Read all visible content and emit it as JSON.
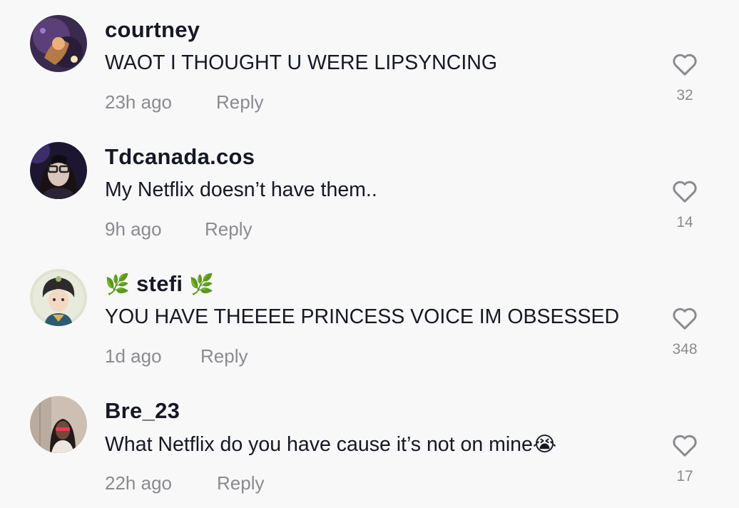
{
  "reply_label": "Reply",
  "comments": [
    {
      "username": "courtney",
      "text": "WAOT I THOUGHT U WERE LIPSYNCING",
      "time": "23h ago",
      "likes": "32"
    },
    {
      "username": "Tdcanada.cos",
      "text": "My Netflix doesn’t have them..",
      "time": "9h ago",
      "likes": "14"
    },
    {
      "username": "stefi",
      "username_prefix": "🌿",
      "username_suffix": "🌿",
      "text": "YOU HAVE THEEEE PRINCESS VOICE IM OBSESSED",
      "time": "1d ago",
      "likes": "348"
    },
    {
      "username": "Bre_23",
      "text": "What Netflix do you have cause it’s not on mine😭",
      "time": "22h ago",
      "likes": "17"
    }
  ],
  "colors": {
    "background": "#f8f8f8",
    "text": "#161823",
    "muted": "#8a8b91"
  },
  "icons": {
    "like": "heart-outline-icon"
  }
}
